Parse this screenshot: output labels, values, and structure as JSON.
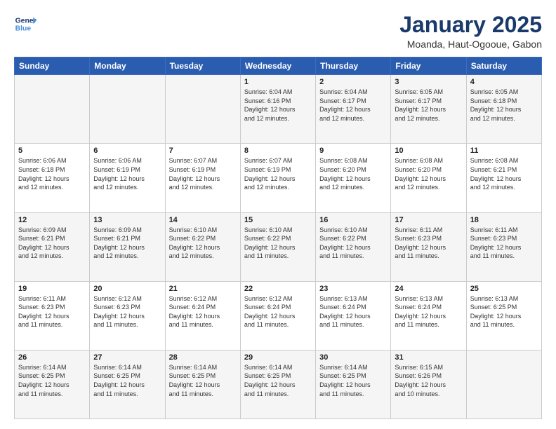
{
  "header": {
    "logo_line1": "General",
    "logo_line2": "Blue",
    "title": "January 2025",
    "subtitle": "Moanda, Haut-Ogooue, Gabon"
  },
  "days_of_week": [
    "Sunday",
    "Monday",
    "Tuesday",
    "Wednesday",
    "Thursday",
    "Friday",
    "Saturday"
  ],
  "weeks": [
    [
      {
        "day": "",
        "info": ""
      },
      {
        "day": "",
        "info": ""
      },
      {
        "day": "",
        "info": ""
      },
      {
        "day": "1",
        "info": "Sunrise: 6:04 AM\nSunset: 6:16 PM\nDaylight: 12 hours\nand 12 minutes."
      },
      {
        "day": "2",
        "info": "Sunrise: 6:04 AM\nSunset: 6:17 PM\nDaylight: 12 hours\nand 12 minutes."
      },
      {
        "day": "3",
        "info": "Sunrise: 6:05 AM\nSunset: 6:17 PM\nDaylight: 12 hours\nand 12 minutes."
      },
      {
        "day": "4",
        "info": "Sunrise: 6:05 AM\nSunset: 6:18 PM\nDaylight: 12 hours\nand 12 minutes."
      }
    ],
    [
      {
        "day": "5",
        "info": "Sunrise: 6:06 AM\nSunset: 6:18 PM\nDaylight: 12 hours\nand 12 minutes."
      },
      {
        "day": "6",
        "info": "Sunrise: 6:06 AM\nSunset: 6:19 PM\nDaylight: 12 hours\nand 12 minutes."
      },
      {
        "day": "7",
        "info": "Sunrise: 6:07 AM\nSunset: 6:19 PM\nDaylight: 12 hours\nand 12 minutes."
      },
      {
        "day": "8",
        "info": "Sunrise: 6:07 AM\nSunset: 6:19 PM\nDaylight: 12 hours\nand 12 minutes."
      },
      {
        "day": "9",
        "info": "Sunrise: 6:08 AM\nSunset: 6:20 PM\nDaylight: 12 hours\nand 12 minutes."
      },
      {
        "day": "10",
        "info": "Sunrise: 6:08 AM\nSunset: 6:20 PM\nDaylight: 12 hours\nand 12 minutes."
      },
      {
        "day": "11",
        "info": "Sunrise: 6:08 AM\nSunset: 6:21 PM\nDaylight: 12 hours\nand 12 minutes."
      }
    ],
    [
      {
        "day": "12",
        "info": "Sunrise: 6:09 AM\nSunset: 6:21 PM\nDaylight: 12 hours\nand 12 minutes."
      },
      {
        "day": "13",
        "info": "Sunrise: 6:09 AM\nSunset: 6:21 PM\nDaylight: 12 hours\nand 12 minutes."
      },
      {
        "day": "14",
        "info": "Sunrise: 6:10 AM\nSunset: 6:22 PM\nDaylight: 12 hours\nand 12 minutes."
      },
      {
        "day": "15",
        "info": "Sunrise: 6:10 AM\nSunset: 6:22 PM\nDaylight: 12 hours\nand 11 minutes."
      },
      {
        "day": "16",
        "info": "Sunrise: 6:10 AM\nSunset: 6:22 PM\nDaylight: 12 hours\nand 11 minutes."
      },
      {
        "day": "17",
        "info": "Sunrise: 6:11 AM\nSunset: 6:23 PM\nDaylight: 12 hours\nand 11 minutes."
      },
      {
        "day": "18",
        "info": "Sunrise: 6:11 AM\nSunset: 6:23 PM\nDaylight: 12 hours\nand 11 minutes."
      }
    ],
    [
      {
        "day": "19",
        "info": "Sunrise: 6:11 AM\nSunset: 6:23 PM\nDaylight: 12 hours\nand 11 minutes."
      },
      {
        "day": "20",
        "info": "Sunrise: 6:12 AM\nSunset: 6:23 PM\nDaylight: 12 hours\nand 11 minutes."
      },
      {
        "day": "21",
        "info": "Sunrise: 6:12 AM\nSunset: 6:24 PM\nDaylight: 12 hours\nand 11 minutes."
      },
      {
        "day": "22",
        "info": "Sunrise: 6:12 AM\nSunset: 6:24 PM\nDaylight: 12 hours\nand 11 minutes."
      },
      {
        "day": "23",
        "info": "Sunrise: 6:13 AM\nSunset: 6:24 PM\nDaylight: 12 hours\nand 11 minutes."
      },
      {
        "day": "24",
        "info": "Sunrise: 6:13 AM\nSunset: 6:24 PM\nDaylight: 12 hours\nand 11 minutes."
      },
      {
        "day": "25",
        "info": "Sunrise: 6:13 AM\nSunset: 6:25 PM\nDaylight: 12 hours\nand 11 minutes."
      }
    ],
    [
      {
        "day": "26",
        "info": "Sunrise: 6:14 AM\nSunset: 6:25 PM\nDaylight: 12 hours\nand 11 minutes."
      },
      {
        "day": "27",
        "info": "Sunrise: 6:14 AM\nSunset: 6:25 PM\nDaylight: 12 hours\nand 11 minutes."
      },
      {
        "day": "28",
        "info": "Sunrise: 6:14 AM\nSunset: 6:25 PM\nDaylight: 12 hours\nand 11 minutes."
      },
      {
        "day": "29",
        "info": "Sunrise: 6:14 AM\nSunset: 6:25 PM\nDaylight: 12 hours\nand 11 minutes."
      },
      {
        "day": "30",
        "info": "Sunrise: 6:14 AM\nSunset: 6:25 PM\nDaylight: 12 hours\nand 11 minutes."
      },
      {
        "day": "31",
        "info": "Sunrise: 6:15 AM\nSunset: 6:26 PM\nDaylight: 12 hours\nand 10 minutes."
      },
      {
        "day": "",
        "info": ""
      }
    ]
  ]
}
